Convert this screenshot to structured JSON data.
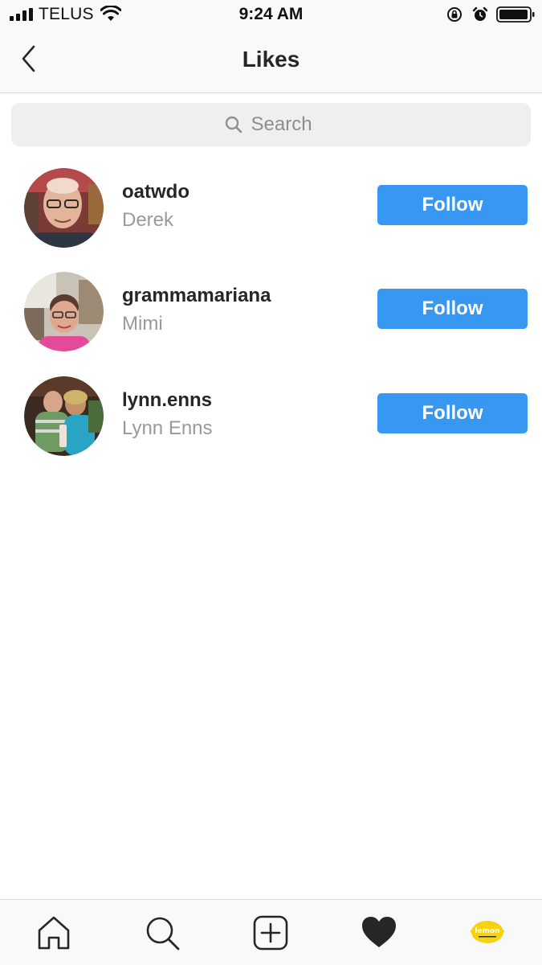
{
  "status_bar": {
    "carrier": "TELUS",
    "time": "9:24 AM"
  },
  "header": {
    "title": "Likes",
    "back_icon": "chevron-left-icon"
  },
  "search": {
    "placeholder": "Search",
    "icon": "search-icon"
  },
  "likes": [
    {
      "username": "oatwdo",
      "name": "Derek",
      "button": "Follow"
    },
    {
      "username": "grammamariana",
      "name": "Mimi",
      "button": "Follow"
    },
    {
      "username": "lynn.enns",
      "name": "Lynn Enns",
      "button": "Follow"
    }
  ],
  "tab_bar": {
    "tabs": [
      "home-icon",
      "search-icon",
      "new-post-icon",
      "activity-heart-icon",
      "profile-avatar"
    ],
    "active": "activity-heart-icon",
    "profile_logo_text": "lemon"
  },
  "colors": {
    "follow_button": "#3897f0",
    "bar_background": "#f9f9f9",
    "search_background": "#efefef",
    "secondary_text": "#999999",
    "profile_logo": "#f5d313"
  }
}
